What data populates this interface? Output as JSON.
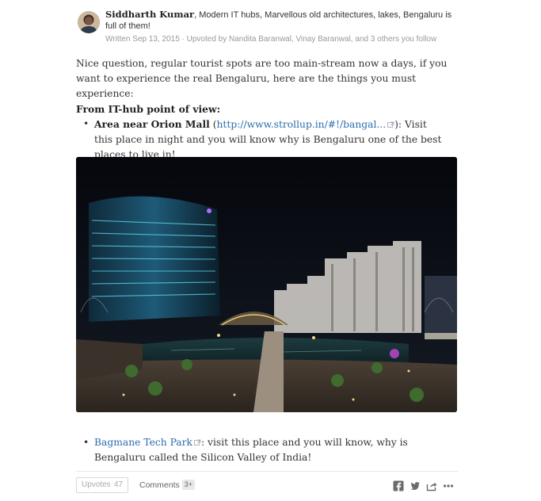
{
  "author": {
    "name": "Siddharth Kumar",
    "bio": ", Modern IT hubs, Marvellous old architectures, lakes, Bengaluru is full of them!",
    "meta": "Written Sep 13, 2015 · Upvoted by Nandita Baranwal, Vinay Baranwal, and 3 others you follow"
  },
  "answer": {
    "intro": "Nice question, regular tourist spots are too main-stream now a days, if you want to experience the real Bengaluru, here are the things you must experience:",
    "section_heading": "From IT-hub point of view:",
    "bullets": [
      {
        "title": "Area near Orion Mall",
        "link_prefix": " (",
        "link_text": "http://www.strollup.in/#!/bangal...",
        "text": "): Visit this place in night and you will know why is Bengaluru one of the best places to live in!"
      },
      {
        "link_text": "Bagmane Tech Park",
        "text": ": visit this place and you will know, why is Bengaluru called the Silicon Valley of India!"
      }
    ]
  },
  "footer": {
    "upvotes_label": "Upvotes",
    "upvotes_count": "47",
    "comments_label": "Comments",
    "comments_count": "3+",
    "share_icons": [
      "facebook-icon",
      "twitter-icon",
      "share-icon",
      "more-icon"
    ]
  }
}
